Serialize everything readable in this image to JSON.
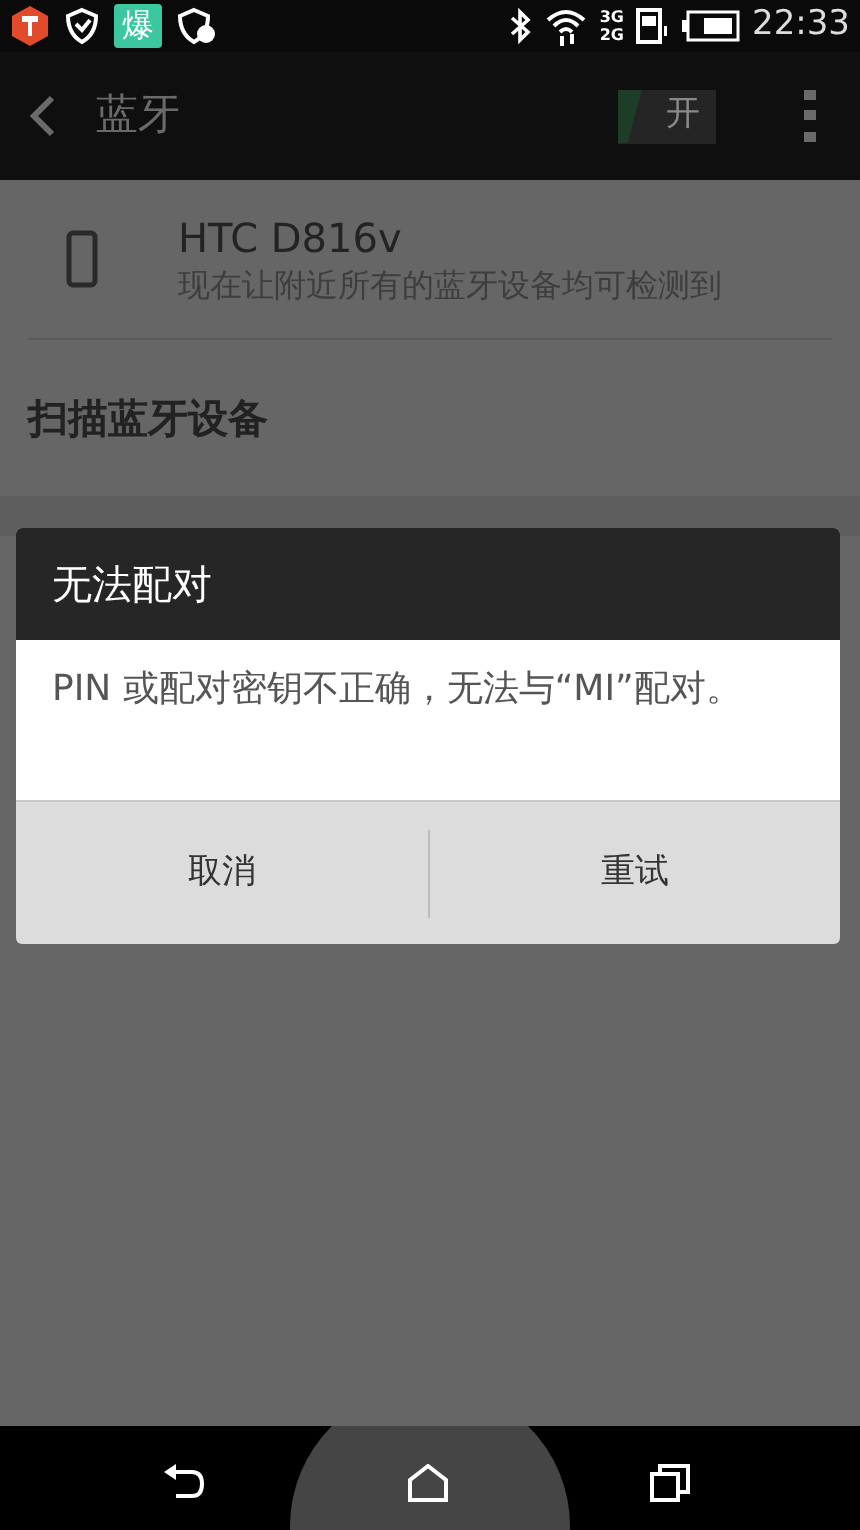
{
  "status_bar": {
    "app_badge": "爆",
    "network_top": "3G",
    "network_bottom": "2G",
    "time": "22:33"
  },
  "action_bar": {
    "title": "蓝牙",
    "toggle": {
      "label": "开",
      "on": true
    }
  },
  "device": {
    "name": "HTC D816v",
    "subtitle": "现在让附近所有的蓝牙设备均可检测到"
  },
  "scan_item": "扫描蓝牙设备",
  "dialog": {
    "title": "无法配对",
    "message": "PIN 或配对密钥不正确，无法与“MI”配对。",
    "buttons": [
      "取消",
      "重试"
    ]
  }
}
